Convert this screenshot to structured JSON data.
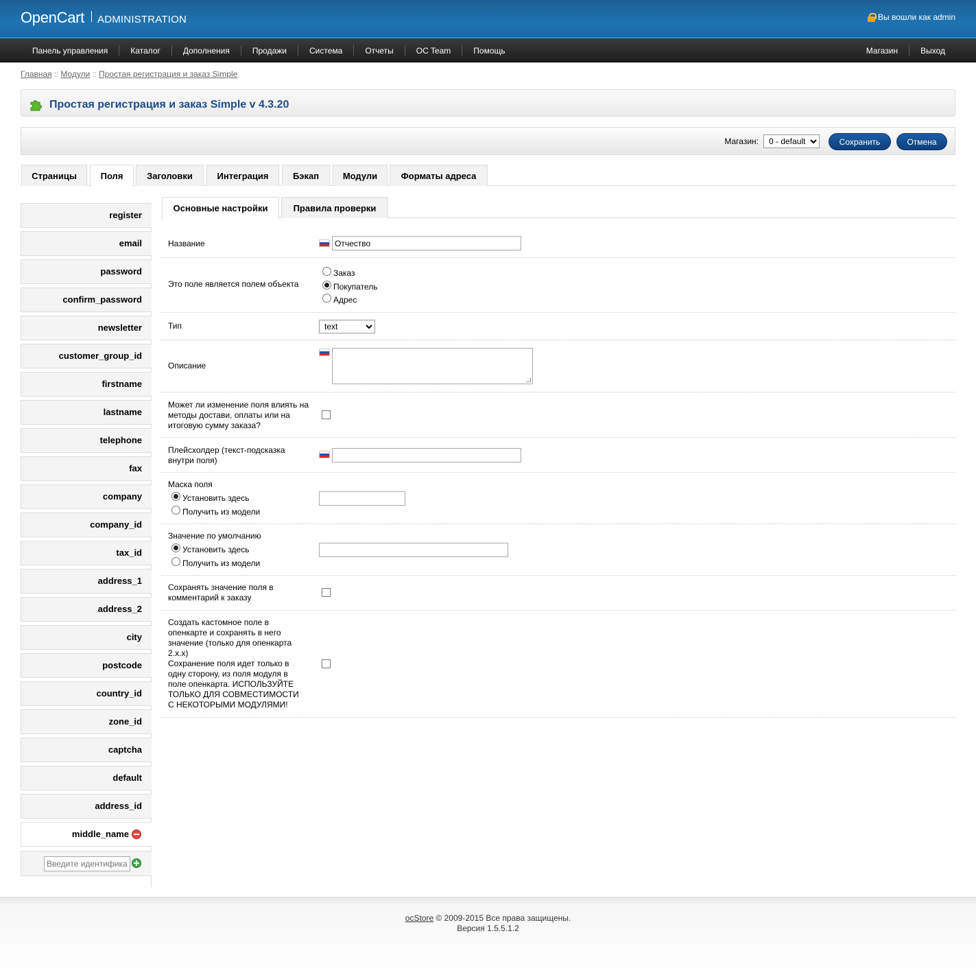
{
  "header": {
    "logo": "OpenCart",
    "subtitle": "ADMINISTRATION",
    "login_info": "Вы вошли как admin"
  },
  "menu": {
    "left": [
      "Панель управления",
      "Каталог",
      "Дополнения",
      "Продажи",
      "Система",
      "Отчеты",
      "OC Team",
      "Помощь"
    ],
    "right": [
      "Магазин",
      "Выход"
    ]
  },
  "breadcrumb": {
    "home": "Главная",
    "modules": "Модули",
    "current": "Простая регистрация и заказ Simple",
    "separator": "::"
  },
  "page": {
    "title": "Простая регистрация и заказ Simple v 4.3.20"
  },
  "toolbar": {
    "store_label": "Магазин:",
    "store_value": "0 - default",
    "save_label": "Сохранить",
    "cancel_label": "Отмена"
  },
  "main_tabs": [
    "Страницы",
    "Поля",
    "Заголовки",
    "Интеграция",
    "Бэкап",
    "Модули",
    "Форматы адреса"
  ],
  "main_tab_active": "Поля",
  "fields": [
    "register",
    "email",
    "password",
    "confirm_password",
    "newsletter",
    "customer_group_id",
    "firstname",
    "lastname",
    "telephone",
    "fax",
    "company",
    "company_id",
    "tax_id",
    "address_1",
    "address_2",
    "city",
    "postcode",
    "country_id",
    "zone_id",
    "captcha",
    "default",
    "address_id",
    "middle_name"
  ],
  "active_field": "middle_name",
  "new_field_placeholder": "Введите идентификатор",
  "sub_tabs": [
    "Основные настройки",
    "Правила проверки"
  ],
  "form": {
    "name_label": "Название",
    "name_value": "Отчество",
    "object_label": "Это поле является полем объекта",
    "object_options": [
      "Заказ",
      "Покупатель",
      "Адрес"
    ],
    "object_selected": "Покупатель",
    "type_label": "Тип",
    "type_value": "text",
    "description_label": "Описание",
    "affects_label": "Может ли изменение поля влиять на методы достави, оплаты или на итоговую сумму заказа?",
    "placeholder_label": "Плейсхолдер (текст-подсказка внутри поля)",
    "mask_label": "Маска поля",
    "mask_options": [
      "Установить здесь",
      "Получить из модели"
    ],
    "default_label": "Значение по умолчанию",
    "default_options": [
      "Установить здесь",
      "Получить из модели"
    ],
    "save_comment_label": "Сохранять значение поля в комментарий к заказу",
    "custom_field_label_1": "Создать кастомное поле в опенкарте и сохранять в него значение (только для опенкарта 2.x.x)",
    "custom_field_label_2": "Сохранение поля идет только в одну сторону, из поля модуля в поле опенкарта. ИСПОЛЬЗУЙТЕ ТОЛЬКО ДЛЯ СОВМЕСТИМОСТИ С НЕКОТОРЫМИ МОДУЛЯМИ!"
  },
  "footer": {
    "link": "ocStore",
    "copyright": " © 2009-2015 Все права защищены.",
    "version": "Версия 1.5.5.1.2"
  }
}
